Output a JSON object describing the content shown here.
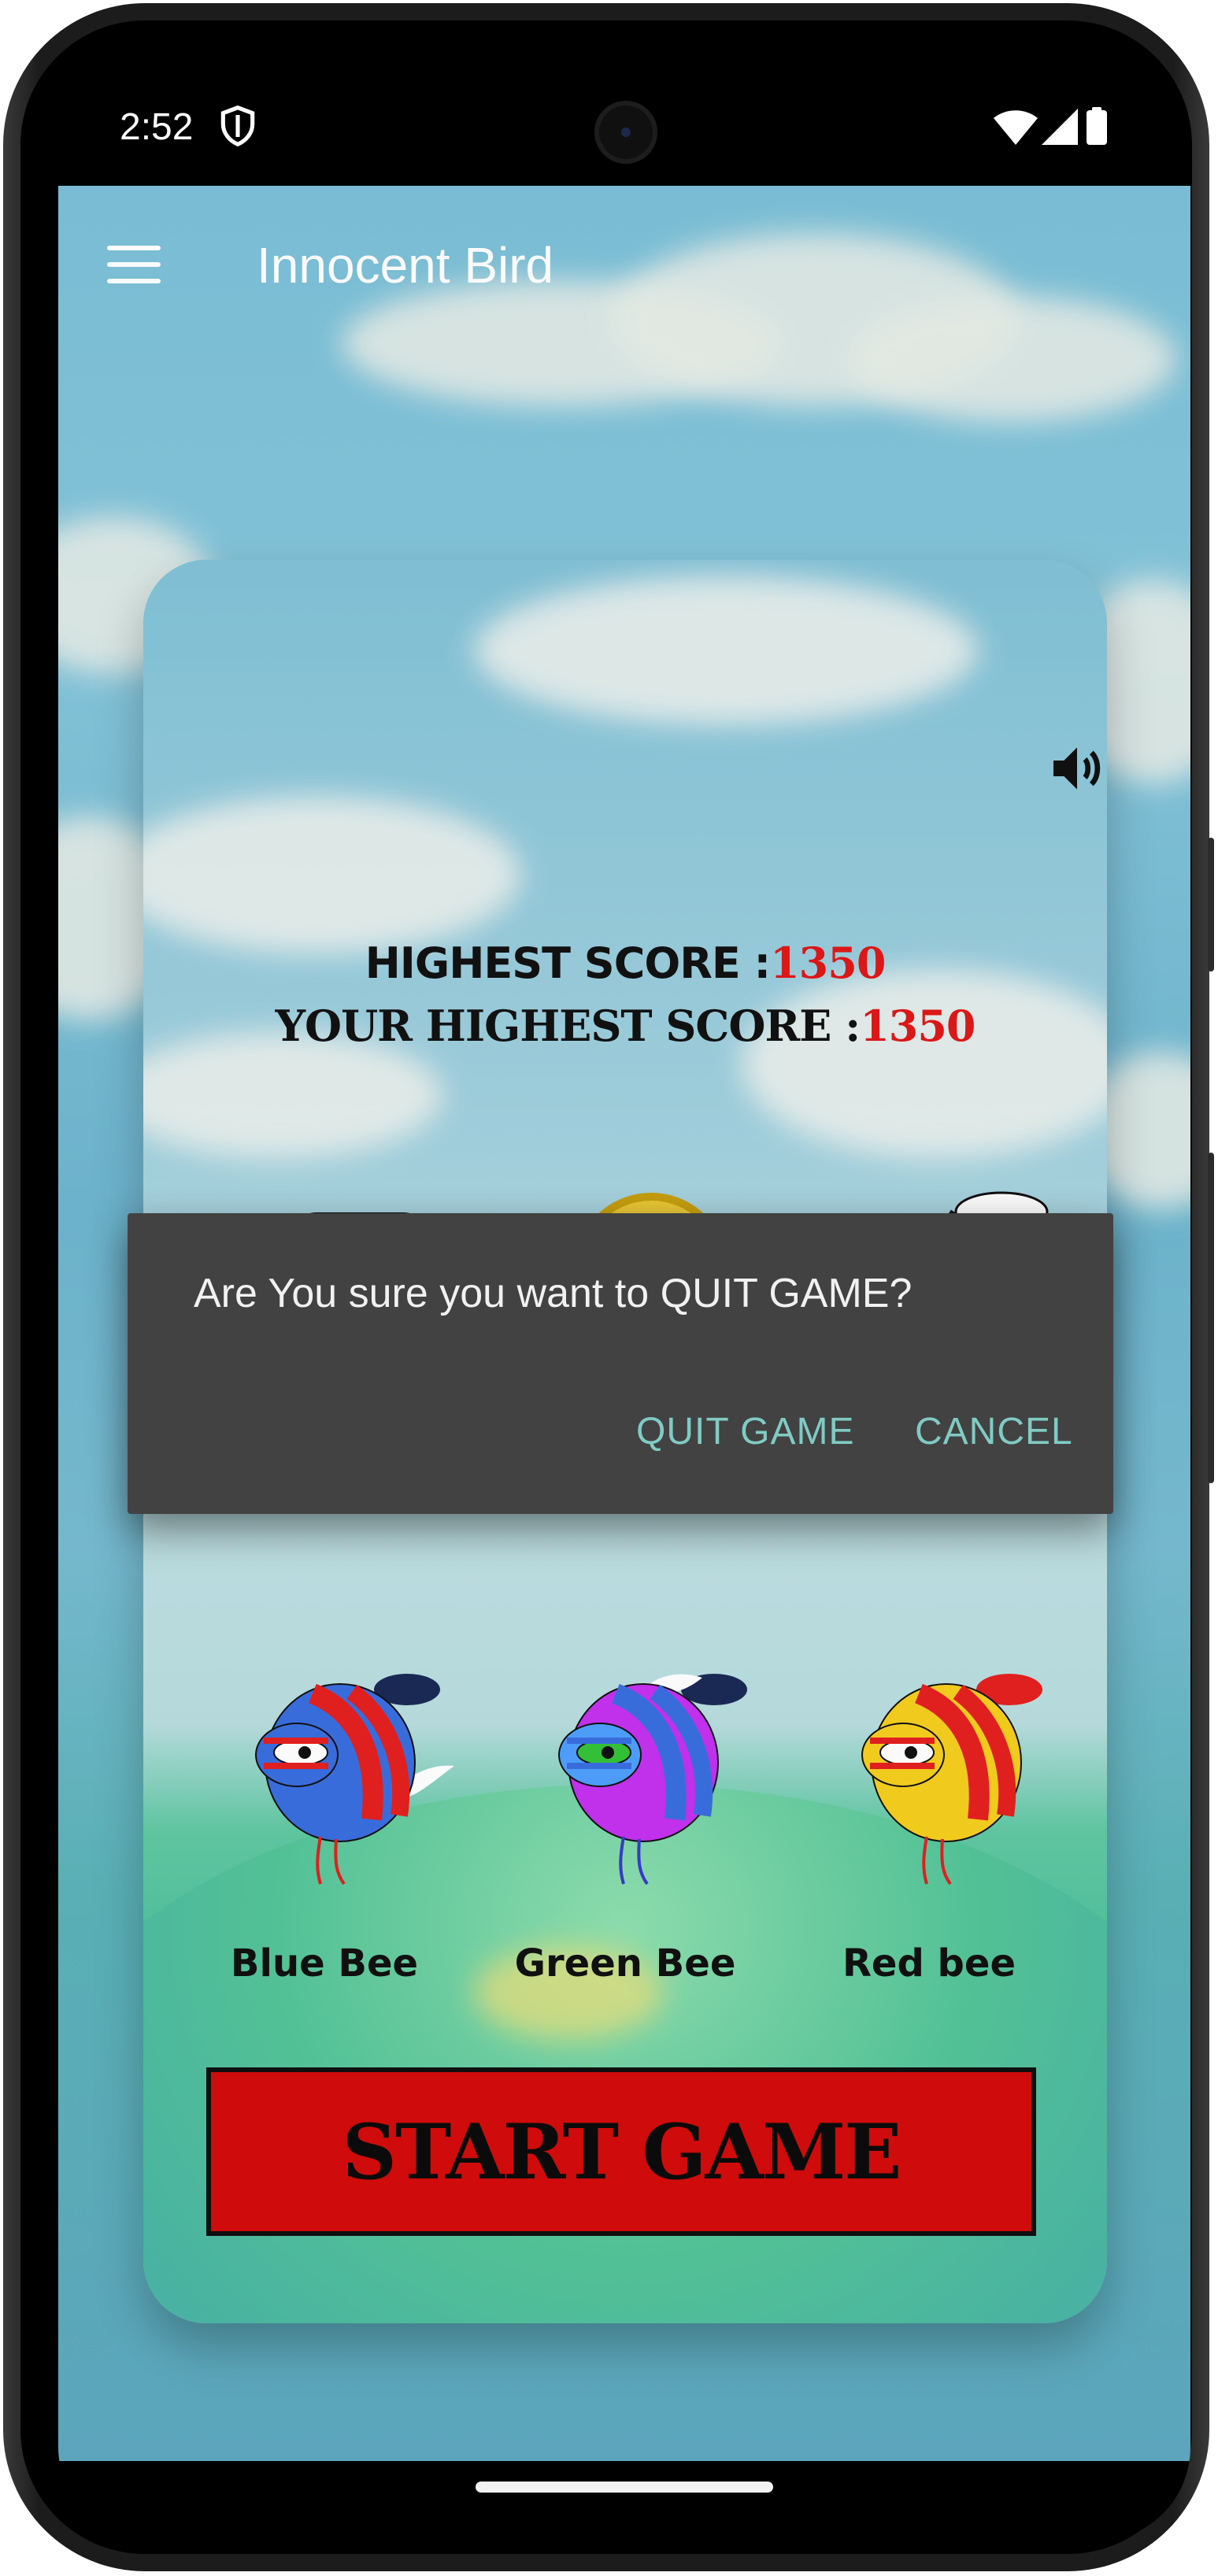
{
  "status_bar": {
    "time": "2:52"
  },
  "app_bar": {
    "title": "Innocent Bird"
  },
  "scores": {
    "highest_label": "HIGHEST SCORE :",
    "highest_value": "1350",
    "your_label": "YOUR HIGHEST SCORE :",
    "your_value": "1350"
  },
  "characters": [
    {
      "name": "blue-bird"
    },
    {
      "name": "gold-coin"
    },
    {
      "name": "yellow-bee"
    }
  ],
  "bees": [
    {
      "label": "Blue Bee",
      "body_color": "#3b6fe0",
      "stripe_color": "#e52020",
      "eye_color": "#ffffff"
    },
    {
      "label": "Green Bee",
      "body_color": "#c531f0",
      "stripe_color": "#3b6fe0",
      "eye_color": "#35c43a"
    },
    {
      "label": "Red bee",
      "body_color": "#f6cf1f",
      "stripe_color": "#e52020",
      "eye_color": "#e52020"
    }
  ],
  "start_button": {
    "label": "START GAME"
  },
  "dialog": {
    "message": "Are You sure you want to QUIT GAME?",
    "confirm_label": "QUIT GAME",
    "cancel_label": "CANCEL"
  },
  "colors": {
    "accent": "#80cbc4",
    "score_value": "#e01818",
    "start_button": "#d40c0c",
    "dialog_bg": "#424242"
  }
}
